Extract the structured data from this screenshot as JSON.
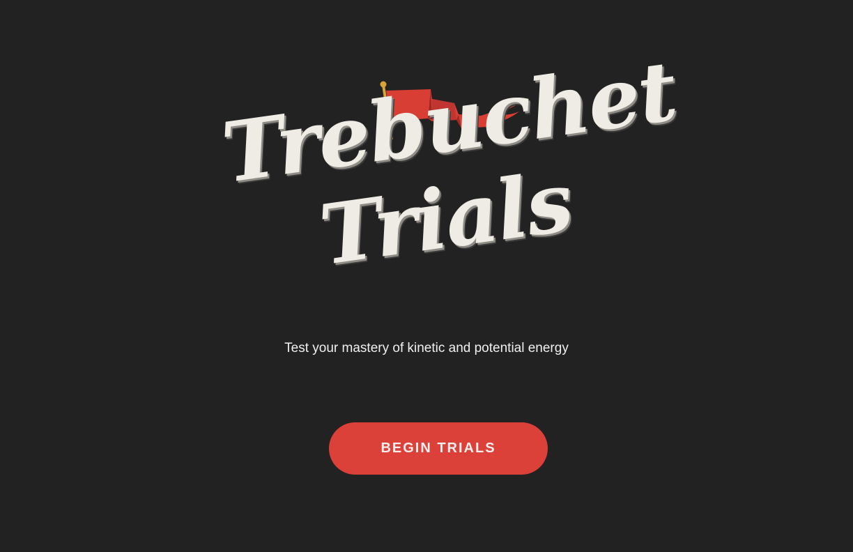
{
  "logo": {
    "line1": "Trebuchet",
    "line2": "Trials",
    "flag_color": "#dc4139",
    "pole_color": "#d9a23a"
  },
  "subtitle": "Test your mastery of kinetic and potential energy",
  "start_button": {
    "label": "BEGIN TRIALS",
    "color": "#dc4139"
  },
  "background_color": "#222222"
}
